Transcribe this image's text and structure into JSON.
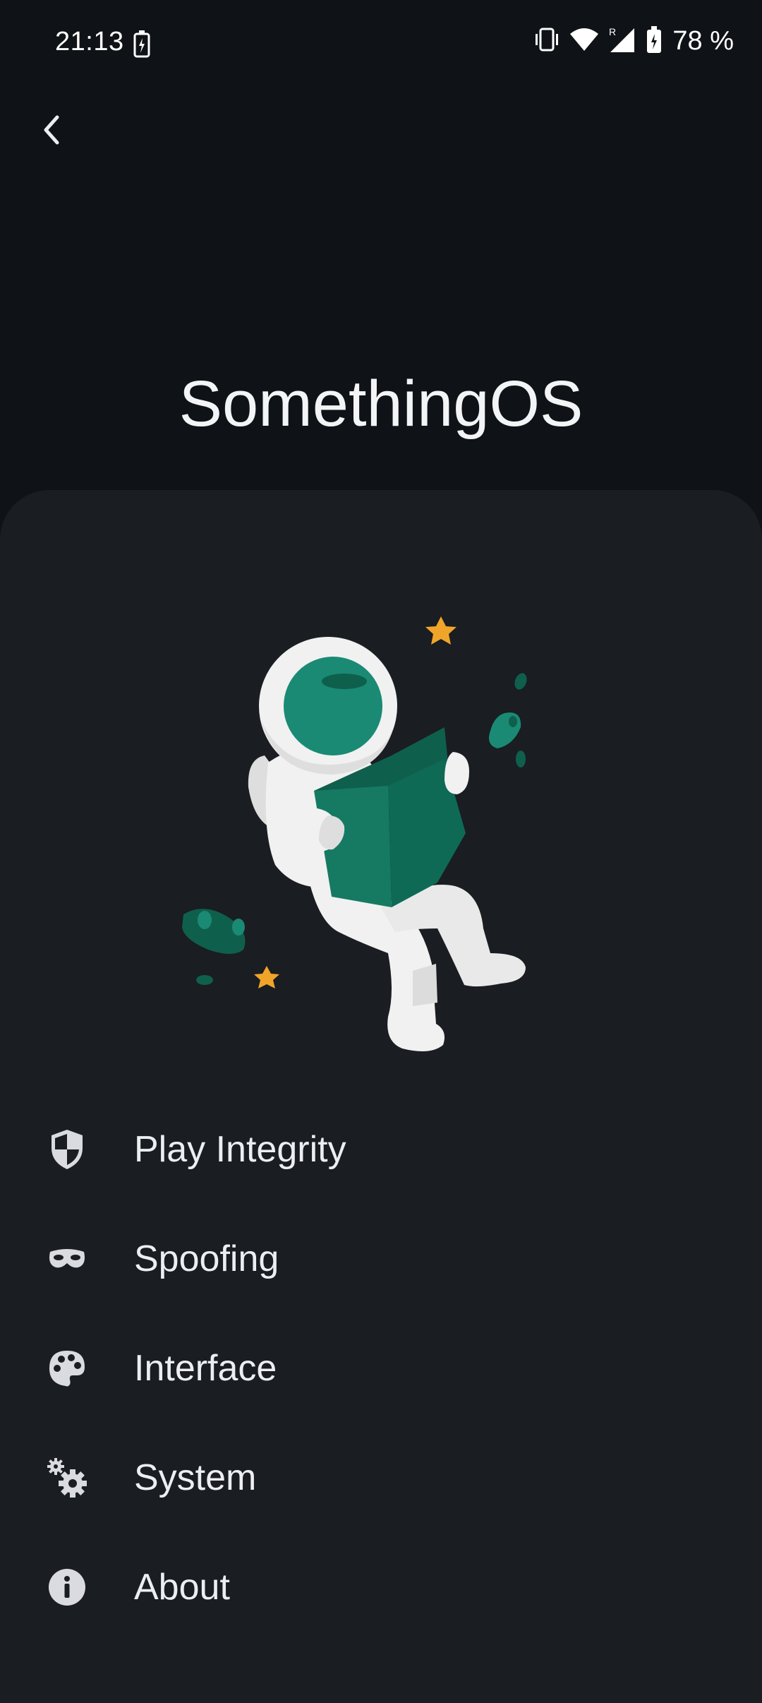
{
  "status_bar": {
    "time": "21:13",
    "battery_percent": "78 %",
    "icons": [
      "battery-charging-icon",
      "vibrate-icon",
      "wifi-icon",
      "roaming-signal-icon",
      "battery-icon"
    ]
  },
  "app_bar": {
    "back_icon": "chevron-left-icon"
  },
  "page": {
    "title": "SomethingOS"
  },
  "illustration": {
    "name": "astronaut-reading-book",
    "colors": {
      "accent": "#1a8a74",
      "accent_dark": "#0f5f4d",
      "star": "#f0a52a",
      "suit": "#f1f1f1"
    }
  },
  "menu": {
    "items": [
      {
        "label": "Play Integrity",
        "icon": "shield-icon"
      },
      {
        "label": "Spoofing",
        "icon": "mask-icon"
      },
      {
        "label": "Interface",
        "icon": "palette-icon"
      },
      {
        "label": "System",
        "icon": "gears-icon"
      },
      {
        "label": "About",
        "icon": "info-icon"
      }
    ]
  },
  "theme": {
    "background": "#0f1216",
    "card": "#1a1d21",
    "text": "#eceef1",
    "icon": "#d9dbe0"
  }
}
